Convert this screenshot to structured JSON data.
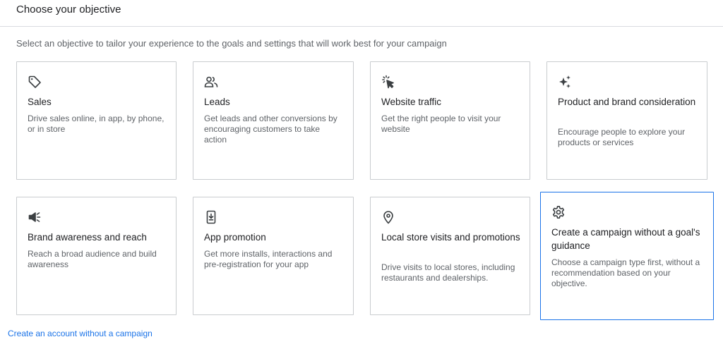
{
  "header": {
    "title": "Choose your objective"
  },
  "subtitle": "Select an objective to tailor your experience to the goals and settings that will work best for your campaign",
  "objectives": [
    {
      "title": "Sales",
      "description": "Drive sales online, in app, by phone, or in store",
      "icon": "tag-icon"
    },
    {
      "title": "Leads",
      "description": "Get leads and other conversions by encouraging customers to take action",
      "icon": "people-icon"
    },
    {
      "title": "Website traffic",
      "description": "Get the right people to visit your website",
      "icon": "cursor-click-icon"
    },
    {
      "title": "Product and brand consideration",
      "description": "Encourage people to explore your products or services",
      "icon": "sparkle-icon"
    },
    {
      "title": "Brand awareness and reach",
      "description": "Reach a broad audience and build awareness",
      "icon": "megaphone-icon"
    },
    {
      "title": "App promotion",
      "description": "Get more installs, interactions and pre-registration for your app",
      "icon": "phone-download-icon"
    },
    {
      "title": "Local store visits and promotions",
      "description": "Drive visits to local stores, including restaurants and dealerships.",
      "icon": "location-pin-icon"
    },
    {
      "title": "Create a campaign without a goal's guidance",
      "description": "Choose a campaign type first, without a recommendation based on your objective.",
      "icon": "gear-icon",
      "selected": true
    }
  ],
  "footer": {
    "link_label": "Create an account without a campaign"
  },
  "colors": {
    "accent": "#1a73e8",
    "border": "#c9cccf",
    "text": "#202124",
    "secondary_text": "#5f6368"
  }
}
